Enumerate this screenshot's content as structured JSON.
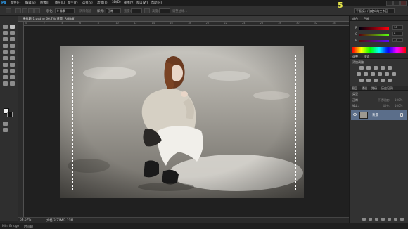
{
  "app": {
    "logo": "Ps"
  },
  "menu": {
    "items": [
      "文件(F)",
      "编辑(E)",
      "图像(I)",
      "图层(L)",
      "文字(Y)",
      "选择(S)",
      "滤镜(T)",
      "3D(D)",
      "视图(V)",
      "窗口(W)",
      "帮助(H)"
    ]
  },
  "options": {
    "feather_label": "羽化:",
    "feather_value": "0 像素",
    "antialias_label": "消除锯齿",
    "style_label": "样式:",
    "style_value": "正常",
    "width_label": "宽度:",
    "height_label": "高度:",
    "refine_label": "调整边缘...",
    "step_number": "5",
    "workspace_value": "平面设计/自定义的工作区"
  },
  "document": {
    "tab_title": "未标题-1.psd @ 66.7%(背景, RGB/8)",
    "ruler_marks": [
      "0",
      "2",
      "4",
      "6",
      "8",
      "10",
      "12",
      "14",
      "16",
      "18",
      "20",
      "22",
      "24",
      "26",
      "28",
      "30",
      "32",
      "34"
    ]
  },
  "status": {
    "zoom": "66.67%",
    "doc_size": "文档:3.21M/3.21M"
  },
  "bridge": {
    "tabs": [
      "Mini Bridge",
      "时间轴"
    ]
  },
  "color_panel": {
    "tabs": [
      "颜色",
      "色板"
    ],
    "rows": [
      {
        "label": "R",
        "value": "90",
        "track": "linear-gradient(to right,#00000d,#ff000d)"
      },
      {
        "label": "G",
        "value": "8",
        "track": "linear-gradient(to right,#5a000d,#5aff0d)"
      },
      {
        "label": "B",
        "value": "73",
        "track": "linear-gradient(to right,#5a0800,#5a08ff)"
      }
    ]
  },
  "adjustments": {
    "tabs": [
      "调整",
      "样式"
    ],
    "hint": "添加调整"
  },
  "layers": {
    "tabs": [
      "图层",
      "通道",
      "路径",
      "历史记录"
    ],
    "filter_label": "类型",
    "blend_label": "正常",
    "opacity_label": "不透明度:",
    "opacity_value": "100%",
    "lock_label": "锁定:",
    "fill_label": "填充:",
    "fill_value": "100%",
    "layer_name": "背景"
  }
}
